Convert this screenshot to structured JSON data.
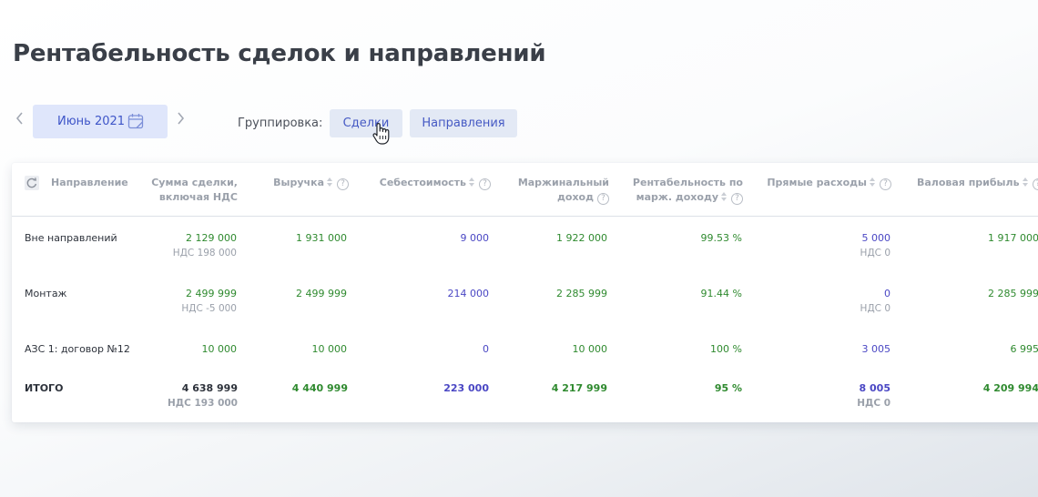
{
  "page": {
    "title": "Рентабельность сделок и направлений"
  },
  "toolbar": {
    "month": "Июнь 2021",
    "grouping_label": "Группировка:",
    "grouping_options": [
      "Сделки",
      "Направления"
    ]
  },
  "table": {
    "headers": {
      "direction": "Направление",
      "deal_sum_1": "Сумма сделки,",
      "deal_sum_2": "включая НДС",
      "revenue": "Выручка",
      "cost": "Себестоимость",
      "margin_1": "Маржинальный",
      "margin_2": "доход",
      "profitability_1": "Рентабельность по",
      "profitability_2": "марж. доходу",
      "direct": "Прямые расходы",
      "gross": "Валовая прибыль"
    },
    "rows": [
      {
        "name": "Вне направлений",
        "deal_sum": "2 129 000",
        "deal_vat": "НДС 198 000",
        "revenue": "1 931 000",
        "cost": "9 000",
        "margin": "1 922 000",
        "profitability": "99.53 %",
        "direct": "5 000",
        "direct_vat": "НДС 0",
        "gross": "1 917 000"
      },
      {
        "name": "Монтаж",
        "deal_sum": "2 499 999",
        "deal_vat": "НДС -5 000",
        "revenue": "2 499 999",
        "cost": "214 000",
        "margin": "2 285 999",
        "profitability": "91.44 %",
        "direct": "0",
        "direct_vat": "НДС 0",
        "gross": "2 285 999"
      },
      {
        "name": "АЗС 1: договор №12",
        "deal_sum": "10 000",
        "deal_vat": "",
        "revenue": "10 000",
        "cost": "0",
        "margin": "10 000",
        "profitability": "100 %",
        "direct": "3 005",
        "direct_vat": "",
        "gross": "6 995"
      }
    ],
    "total": {
      "name": "ИТОГО",
      "deal_sum": "4 638 999",
      "deal_vat": "НДС 193 000",
      "revenue": "4 440 999",
      "cost": "223 000",
      "margin": "4 217 999",
      "profitability": "95 %",
      "direct": "8 005",
      "direct_vat": "НДС 0",
      "gross": "4 209 994"
    }
  },
  "colors": {
    "positive": "#2f8a2f",
    "link": "#4a47c4",
    "accent_bg": "#dfe6fb"
  },
  "icons": [
    "chevron-left-icon",
    "calendar-icon",
    "chevron-right-icon",
    "hand-cursor-icon",
    "refresh-icon",
    "sort-icon",
    "help-icon"
  ]
}
